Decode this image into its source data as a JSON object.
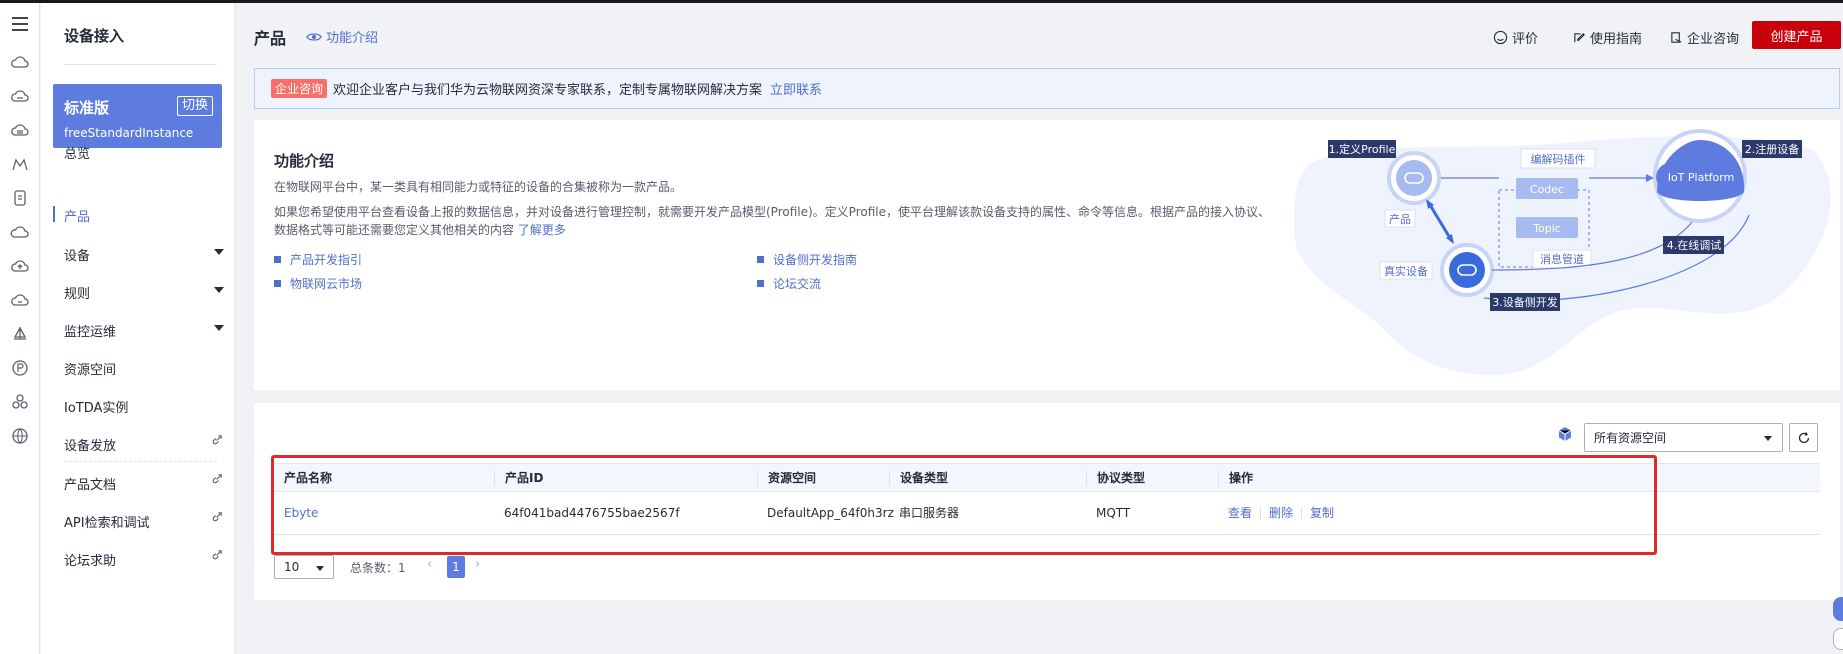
{
  "sidebar": {
    "title": "设备接入",
    "instance": {
      "name": "标准版",
      "switch_label": "切换",
      "id": "freeStandardInstance"
    },
    "items": [
      {
        "label": "总览"
      },
      {
        "label": "产品"
      },
      {
        "label": "设备"
      },
      {
        "label": "规则"
      },
      {
        "label": "监控运维"
      },
      {
        "label": "资源空间"
      },
      {
        "label": "IoTDA实例"
      },
      {
        "label": "设备发放"
      },
      {
        "label": "产品文档"
      },
      {
        "label": "API检索和调试"
      },
      {
        "label": "论坛求助"
      }
    ]
  },
  "header": {
    "title": "产品",
    "intro_link": "功能介绍",
    "rate": "评价",
    "guide": "使用指南",
    "consult": "企业咨询",
    "create_button": "创建产品"
  },
  "banner": {
    "badge": "企业咨询",
    "text": "欢迎企业客户与我们华为云物联网资深专家联系，定制专属物联网解决方案",
    "link": "立即联系"
  },
  "intro": {
    "title": "功能介绍",
    "desc1": "在物联网平台中，某一类具有相同能力或特征的设备的合集被称为一款产品。",
    "desc2": "如果您希望使用平台查看设备上报的数据信息，并对设备进行管理控制，就需要开发产品模型(Profile)。定义Profile，使平台理解该款设备支持的属性、命令等信息。根据产品的接入协议、数据格式等可能还需要您定义其他相关的内容",
    "more": "了解更多",
    "links": [
      "产品开发指引",
      "设备侧开发指南",
      "物联网云市场",
      "论坛交流"
    ],
    "diagram": {
      "step1": "1.定义Profile",
      "step2": "2.注册设备",
      "step3": "3.设备侧开发",
      "step4": "4.在线调试",
      "codec_plugin": "编解码插件",
      "codec": "Codec",
      "topic": "Topic",
      "msg_pipe": "消息管道",
      "product": "产品",
      "real_device": "真实设备",
      "platform": "IoT Platform"
    }
  },
  "table": {
    "resource_space": "所有资源空间",
    "columns": [
      "产品名称",
      "产品ID",
      "资源空间",
      "设备类型",
      "协议类型",
      "操作"
    ],
    "rows": [
      {
        "name": "Ebyte",
        "id": "64f041bad4476755bae2567f",
        "space": "DefaultApp_64f0h3rz",
        "type": "串口服务器",
        "protocol": "MQTT"
      }
    ],
    "actions": [
      "查看",
      "删除",
      "复制"
    ]
  },
  "pagination": {
    "page_size": "10",
    "total_label": "总条数：1",
    "current_page": "1"
  },
  "colors": {
    "accent": "#5e7ce0",
    "link": "#526ecc",
    "create": "#c7000b",
    "highlight": "#e02a2a"
  }
}
